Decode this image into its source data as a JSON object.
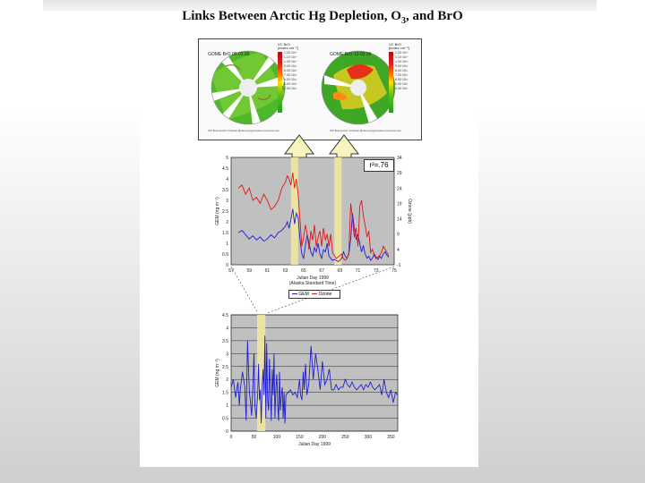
{
  "slide": {
    "title_main": "Links Between Arctic Hg Depletion, O",
    "title_sub": "3",
    "title_end": ", and BrO"
  },
  "maps": [
    {
      "label": "GOME BrO 05.03.99",
      "vc_label": "VC BrO",
      "vc_units": "[molec cm⁻²]",
      "credit": "IUP Bremen/ALI Institute Meteorology/physik.uni-bremen.de",
      "scale": [
        "1.20·10¹⁴",
        "1.10·10¹⁴",
        "1.00·10¹⁴",
        "9.00·10¹³",
        "8.00·10¹³",
        "7.00·10¹³",
        "6.00·10¹³",
        "5.00·10¹³",
        "4.00·10¹³"
      ]
    },
    {
      "label": "GOME BrO 10.03.99",
      "vc_label": "VC BrO",
      "vc_units": "[molec cm⁻²]",
      "credit": "IUP Bremen/ALI Institute Meteorology/physik.uni-bremen.de",
      "scale": [
        "1.20·10¹⁴",
        "1.10·10¹⁴",
        "1.00·10¹⁴",
        "9.00·10¹³",
        "8.00·10¹³",
        "7.00·10¹³",
        "6.00·10¹³",
        "5.00·10¹³",
        "4.00·10¹³"
      ]
    }
  ],
  "chart_data": [
    {
      "type": "line",
      "xlabel": "Julian Day 1999",
      "xlabel2": "(Alaska Standard Time)",
      "ylabel": "GEM (ng m⁻³)",
      "ylabel2": "Ozone (ppb)",
      "xlim": [
        57,
        75
      ],
      "ylim": [
        0,
        5
      ],
      "y2lim": [
        -1,
        34
      ],
      "xticks": [
        57,
        59,
        61,
        63,
        65,
        67,
        69,
        71,
        73,
        75
      ],
      "yticks": [
        0,
        0.5,
        1,
        1.5,
        2,
        2.5,
        3,
        3.5,
        4,
        4.5,
        5
      ],
      "y2ticks": [
        -1,
        4,
        9,
        14,
        19,
        24,
        29,
        34
      ],
      "annotation": "r²=.76",
      "legend_gem": "GEM",
      "legend_ozone": "Ozone",
      "highlight": [
        [
          63.6,
          64.4
        ],
        [
          68.4,
          69.2
        ]
      ],
      "series": [
        {
          "name": "GEM",
          "color": "#1f1fd0",
          "axis": "left",
          "x": [
            57.8,
            58.2,
            58.6,
            59,
            59.4,
            59.8,
            60.2,
            60.6,
            61,
            61.4,
            61.8,
            62.2,
            62.6,
            63,
            63.2,
            63.4,
            63.6,
            63.8,
            64,
            64.2,
            64.4,
            64.6,
            64.8,
            65,
            65.2,
            65.4,
            65.6,
            65.8,
            66,
            66.2,
            66.4,
            66.6,
            66.8,
            67,
            67.2,
            67.4,
            67.6,
            67.8,
            68,
            68.2,
            68.4,
            68.6,
            68.8,
            69,
            69.2,
            69.4,
            69.6,
            69.8,
            70,
            70.2,
            70.4,
            70.6,
            70.8,
            71,
            71.2,
            71.4,
            71.6,
            71.8,
            72,
            72.2,
            72.4,
            72.6,
            72.8,
            73,
            73.2,
            73.4,
            73.6,
            73.8,
            74,
            74.2,
            74.4
          ],
          "y": [
            1.5,
            1.6,
            1.4,
            1.2,
            1.35,
            1.15,
            1.3,
            1.1,
            1.2,
            1.4,
            1.25,
            1.5,
            1.6,
            1.8,
            2.0,
            1.7,
            2.1,
            2.6,
            1.9,
            2.4,
            2.2,
            1.2,
            0.5,
            0.3,
            0.9,
            1.4,
            1.0,
            0.6,
            0.4,
            0.8,
            0.6,
            1.0,
            0.5,
            0.3,
            0.7,
            0.6,
            1.0,
            0.4,
            0.3,
            0.2,
            0.25,
            0.2,
            0.15,
            0.2,
            0.3,
            0.6,
            0.4,
            0.3,
            0.5,
            1.2,
            2.4,
            1.7,
            1.2,
            1.4,
            1.0,
            0.6,
            0.9,
            0.5,
            0.3,
            0.4,
            0.2,
            0.3,
            0.5,
            0.35,
            0.25,
            0.4,
            0.3,
            0.5,
            0.6,
            0.45,
            0.35
          ]
        },
        {
          "name": "Ozone",
          "color": "#e01515",
          "axis": "right",
          "x": [
            57.8,
            58.2,
            58.6,
            59,
            59.4,
            59.8,
            60.2,
            60.6,
            61,
            61.4,
            61.8,
            62.2,
            62.6,
            63,
            63.2,
            63.4,
            63.6,
            63.8,
            64,
            64.2,
            64.4,
            64.6,
            64.8,
            65,
            65.2,
            65.4,
            65.6,
            65.8,
            66,
            66.2,
            66.4,
            66.6,
            66.8,
            67,
            67.2,
            67.4,
            67.6,
            67.8,
            68,
            68.2,
            68.4,
            68.6,
            68.8,
            69,
            69.2,
            69.4,
            69.6,
            69.8,
            70,
            70.2,
            70.4,
            70.6,
            70.8,
            71,
            71.2,
            71.4,
            71.6,
            71.8,
            72,
            72.2,
            72.4,
            72.6,
            72.8,
            73,
            73.2,
            73.4,
            73.6,
            73.8,
            74,
            74.2,
            74.4
          ],
          "y": [
            24,
            25,
            22,
            24,
            20,
            21,
            19,
            22,
            20,
            17,
            18,
            20,
            24,
            26,
            28,
            27,
            25,
            29,
            24,
            27,
            22,
            14,
            5,
            8,
            12,
            9,
            4,
            10,
            7,
            12,
            5,
            8,
            10,
            5,
            11,
            7,
            9,
            5,
            9,
            3,
            2,
            1,
            1.5,
            2,
            2.5,
            1,
            0.5,
            1,
            3,
            19,
            14,
            8,
            11,
            5,
            18,
            20,
            15,
            12,
            8,
            10,
            3,
            4,
            2,
            1,
            1.5,
            2,
            3,
            5,
            4,
            3,
            2
          ]
        }
      ]
    },
    {
      "type": "line",
      "xlabel": "Julian Day 1999",
      "ylabel": "GEM (ng m⁻³)",
      "xlim": [
        0,
        365
      ],
      "ylim": [
        0,
        4.5
      ],
      "xticks": [
        0,
        50,
        100,
        150,
        200,
        250,
        300,
        350
      ],
      "yticks": [
        0,
        0.5,
        1,
        1.5,
        2,
        2.5,
        3,
        3.5,
        4,
        4.5
      ],
      "highlight": [
        [
          57,
          75
        ]
      ],
      "series": [
        {
          "name": "GEM",
          "color": "#1f1fd0",
          "x": [
            0,
            5,
            10,
            15,
            18,
            20,
            25,
            30,
            33,
            36,
            40,
            42,
            45,
            48,
            50,
            52,
            55,
            58,
            60,
            62,
            64,
            66,
            68,
            70,
            72,
            74,
            76,
            78,
            80,
            82,
            84,
            86,
            88,
            90,
            92,
            94,
            96,
            98,
            100,
            102,
            104,
            106,
            108,
            110,
            112,
            114,
            116,
            118,
            120,
            125,
            130,
            135,
            140,
            145,
            150,
            152,
            155,
            158,
            160,
            163,
            166,
            170,
            175,
            180,
            185,
            190,
            195,
            200,
            205,
            210,
            215,
            220,
            225,
            230,
            235,
            240,
            245,
            250,
            255,
            260,
            265,
            270,
            275,
            280,
            285,
            290,
            295,
            300,
            305,
            310,
            315,
            320,
            325,
            330,
            335,
            340,
            345,
            350,
            355,
            360,
            365
          ],
          "y": [
            1.7,
            2.0,
            1.3,
            1.9,
            1.0,
            1.6,
            2.3,
            1.7,
            0.4,
            3.5,
            1.5,
            1.2,
            0.6,
            1.9,
            3.0,
            1.0,
            0.5,
            1.4,
            2.6,
            1.2,
            1.6,
            0.3,
            1.8,
            2.4,
            1.4,
            3.7,
            0.5,
            3.4,
            1.2,
            0.8,
            2.8,
            1.6,
            0.4,
            2.4,
            1.4,
            3.0,
            0.5,
            1.6,
            2.2,
            1.0,
            0.4,
            2.3,
            0.8,
            1.4,
            1.7,
            0.5,
            1.5,
            0.3,
            1.4,
            1.5,
            1.6,
            1.4,
            1.5,
            1.3,
            2.0,
            1.4,
            1.2,
            2.3,
            1.6,
            2.6,
            1.4,
            1.8,
            3.3,
            2.0,
            3.0,
            2.4,
            1.6,
            2.7,
            1.8,
            2.0,
            2.4,
            1.6,
            1.6,
            1.8,
            1.6,
            1.7,
            1.7,
            2.0,
            1.8,
            1.7,
            1.9,
            1.7,
            1.6,
            1.7,
            1.8,
            1.6,
            1.8,
            1.7,
            1.9,
            1.7,
            1.6,
            1.7,
            1.8,
            1.4,
            2.0,
            1.5,
            1.3,
            1.6,
            1.1,
            1.5,
            1.4
          ]
        }
      ]
    }
  ]
}
